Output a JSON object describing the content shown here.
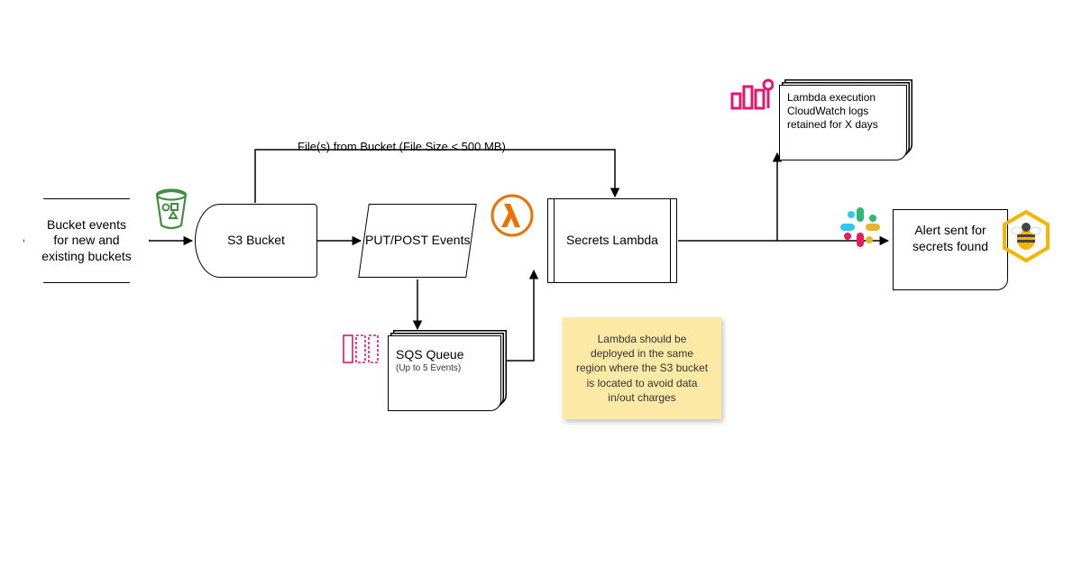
{
  "nodes": {
    "bucket_events": "Bucket events for new and existing buckets",
    "s3_bucket": "S3 Bucket",
    "put_post": "PUT/POST Events",
    "sqs_title": "SQS Queue",
    "sqs_sub": "(Up to 5 Events)",
    "secrets_lambda": "Secrets Lambda",
    "cloudwatch": "Lambda execution CloudWatch logs retained for X days",
    "alert": "Alert sent for secrets found"
  },
  "labels": {
    "files_from_bucket": "File(s) from Bucket (File Size < 500 MB)"
  },
  "note": "Lambda should be deployed in the same region where the S3 bucket is located to avoid data in/out charges",
  "icons": {
    "bucket": "s3-bucket",
    "lambda": "lambda",
    "sqs": "sqs",
    "cloudwatch": "cloudwatch-metric",
    "slack": "slack",
    "honeycomb": "honeycomb"
  },
  "colors": {
    "s3_green": "#3f8f3f",
    "lambda_orange": "#ed7100",
    "sqs_pink": "#e2176f",
    "cloudwatch_pink": "#e2176f",
    "honeycomb_yellow": "#f4b400"
  }
}
